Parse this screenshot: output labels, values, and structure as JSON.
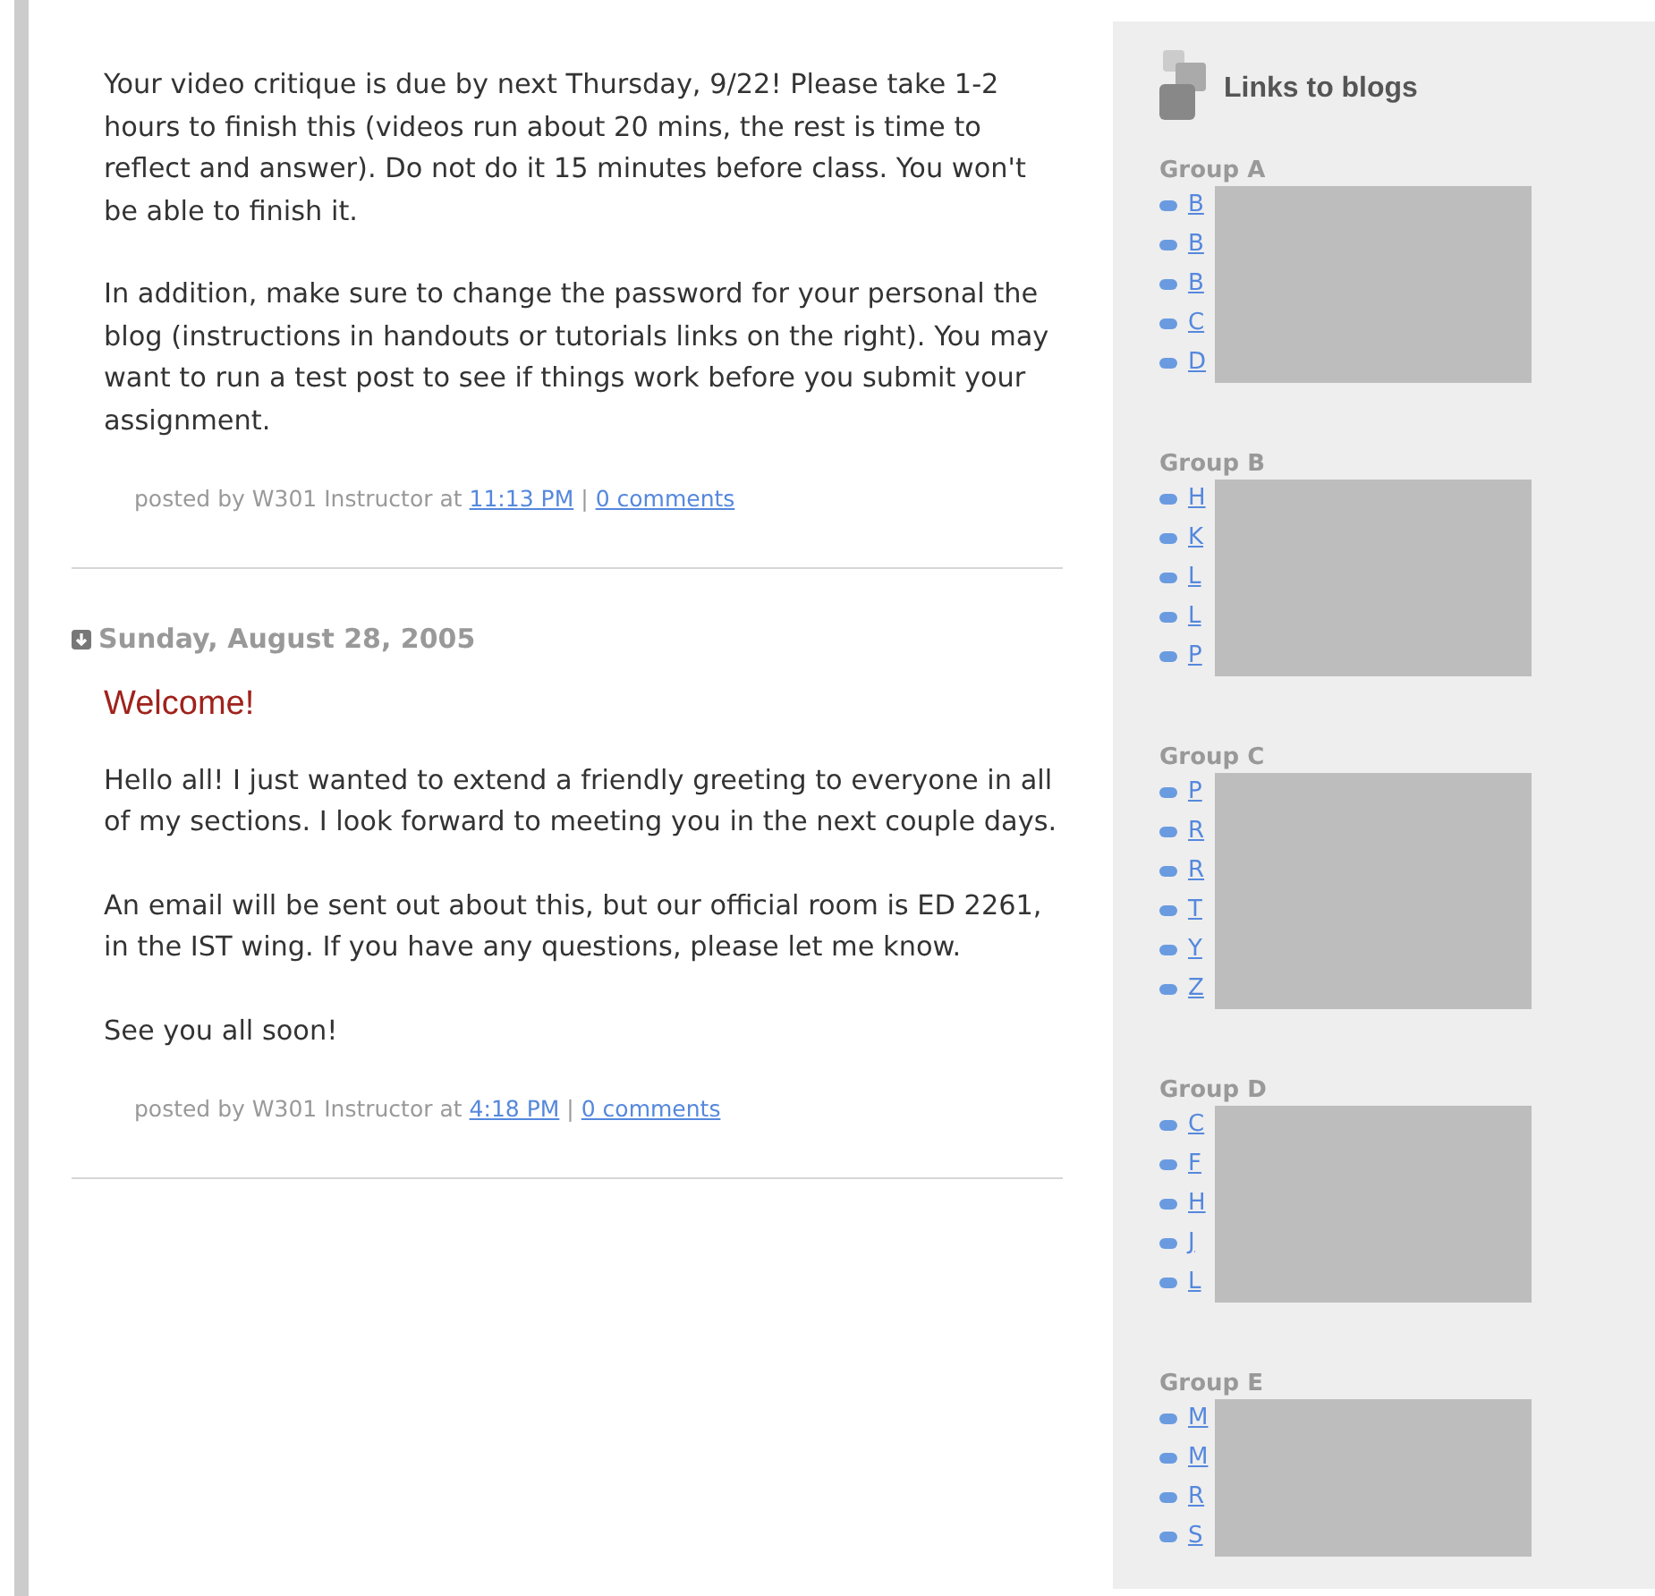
{
  "posts": [
    {
      "paragraphs": [
        "Your video critique is due by next Thursday, 9/22! Please take 1-2 hours to finish this (videos run about 20 mins, the rest is time to reflect and answer). Do not do it 15 minutes before class. You won't be able to finish it.",
        "In addition, make sure to change the password for your personal the blog (instructions in handouts or tutorials links on the right). You may want to run a test post to see if things work before you submit your assignment."
      ],
      "footer": {
        "prefix": "posted by W301 Instructor at",
        "time": "11:13 PM",
        "separator": "|",
        "comments": "0 comments"
      }
    },
    {
      "date": "Sunday, August 28, 2005",
      "title": "Welcome!",
      "paragraphs": [
        "Hello all! I just wanted to extend a friendly greeting to everyone in all of my sections. I look forward to meeting you in the next couple days.",
        "An email will be sent out about this, but our official room is ED 2261, in the IST wing. If you have any questions, please let me know.",
        "See you all soon!"
      ],
      "footer": {
        "prefix": "posted by W301 Instructor at",
        "time": "4:18 PM",
        "separator": "|",
        "comments": "0 comments"
      }
    }
  ],
  "sidebar": {
    "title": "Links to blogs",
    "groups": [
      {
        "name": "Group A",
        "links": [
          "B",
          "B",
          "B",
          "C",
          "D"
        ]
      },
      {
        "name": "Group B",
        "links": [
          "H",
          "K",
          "L",
          "L",
          "P"
        ]
      },
      {
        "name": "Group C",
        "links": [
          "P",
          "R",
          "R",
          "T",
          "Y",
          "Z"
        ]
      },
      {
        "name": "Group D",
        "links": [
          "C",
          "F",
          "H",
          "J",
          "L"
        ]
      },
      {
        "name": "Group E",
        "links": [
          "M",
          "M",
          "R",
          "S"
        ]
      }
    ]
  }
}
